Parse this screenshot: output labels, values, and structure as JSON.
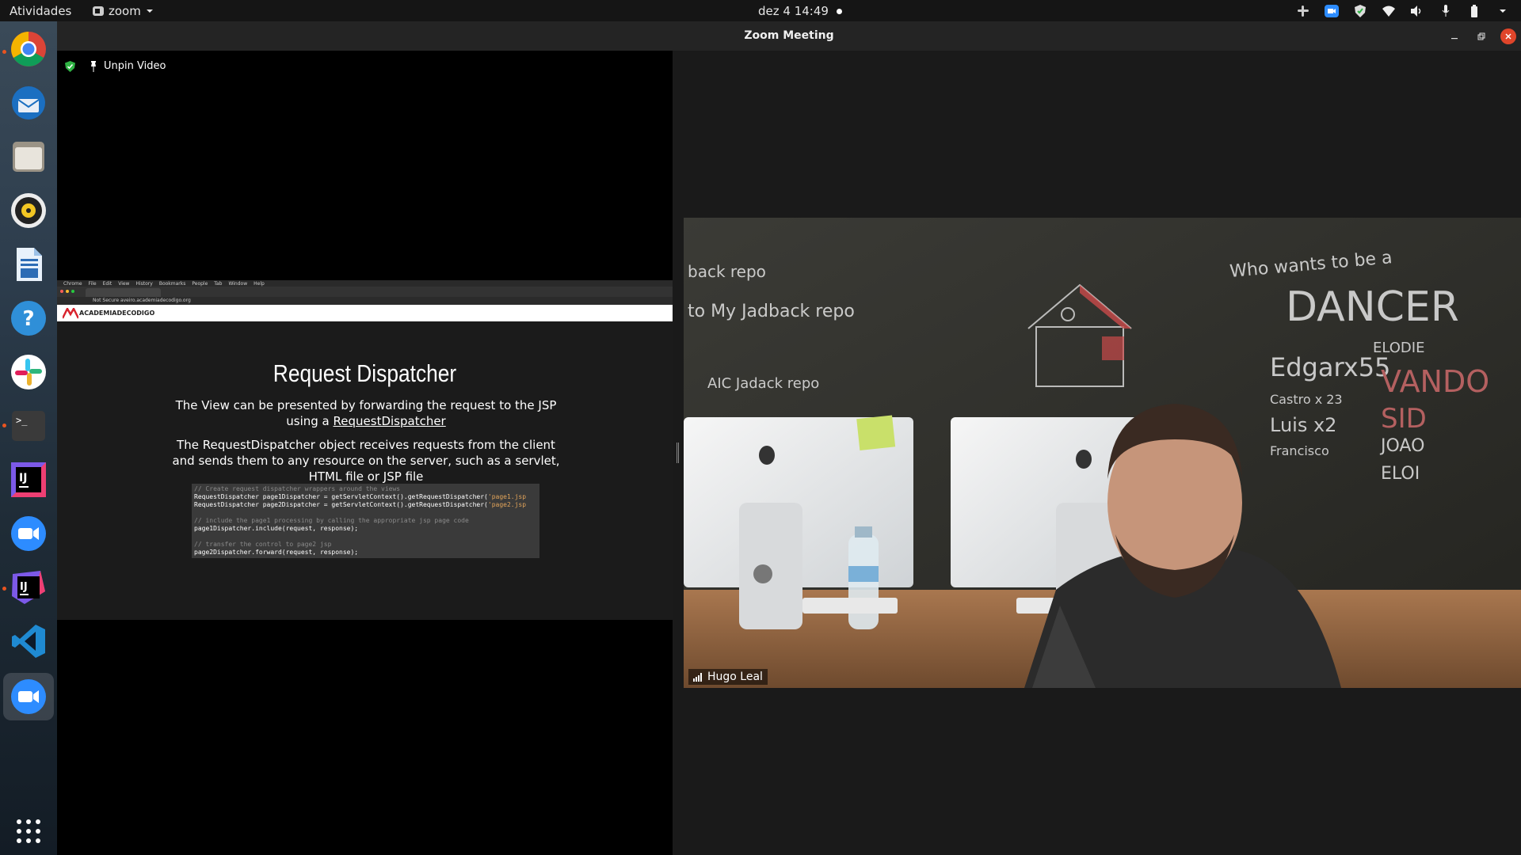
{
  "topbar": {
    "activities": "Atividades",
    "app_name": "zoom",
    "clock": "dez 4  14:49"
  },
  "dock": {
    "items": [
      "chrome-icon",
      "thunderbird-icon",
      "files-icon",
      "rhythmbox-icon",
      "writer-icon",
      "help-icon",
      "slack-icon",
      "terminal-icon",
      "intellij-icon",
      "zoom-icon",
      "intellij-toolbox-icon",
      "vscode-icon",
      "zoom-active-icon",
      "show-apps-icon"
    ]
  },
  "window": {
    "title": "Zoom Meeting"
  },
  "share": {
    "unpin_label": "Unpin Video",
    "slide": {
      "title": "Request Dispatcher",
      "para1_prefix": "The View can be presented by forwarding the request to the JSP using a ",
      "para1_link": "RequestDispatcher",
      "para2": "The RequestDispatcher object receives requests from the client and sends them to any resource on the server, such as a servlet, HTML file or JSP file",
      "code": {
        "c1": "// Create request dispatcher wrappers around the views",
        "l1a": "RequestDispatcher page1Dispatcher = getServletContext().getRequestDispatcher(",
        "l1b": "'page1.jsp",
        "l2a": "RequestDispatcher page2Dispatcher = getServletContext().getRequestDispatcher(",
        "l2b": "'page2.jsp",
        "c2": "// include the page1 processing by calling the appropriate jsp page code",
        "l3": "page1Dispatcher.include(request, response);",
        "c3": "// transfer the control to page2 jsp",
        "l4": "page2Dispatcher.forward(request, response);"
      },
      "browser_menu": [
        "Chrome",
        "File",
        "Edit",
        "View",
        "History",
        "Bookmarks",
        "People",
        "Tab",
        "Window",
        "Help"
      ],
      "url_text": "Not Secure   aveiro.academiadecodigo.org",
      "site_logo": "ACADEMIADECODIGO"
    }
  },
  "video": {
    "participant_name": "Hugo Leal",
    "board_text": [
      "Who wants to be a",
      "DANCER",
      "ELODIE",
      "Edgarx55",
      "VANDO",
      "SID",
      "Luis x2",
      "JOAO",
      "ELOI",
      "Francisco",
      "Castro x 23",
      "to My Jadback repo",
      "back repo",
      "AIC Jadack repo"
    ]
  },
  "colors": {
    "ubuntu_orange": "#e95420",
    "secure_green": "#2fb344",
    "close_red": "#e0452a"
  }
}
